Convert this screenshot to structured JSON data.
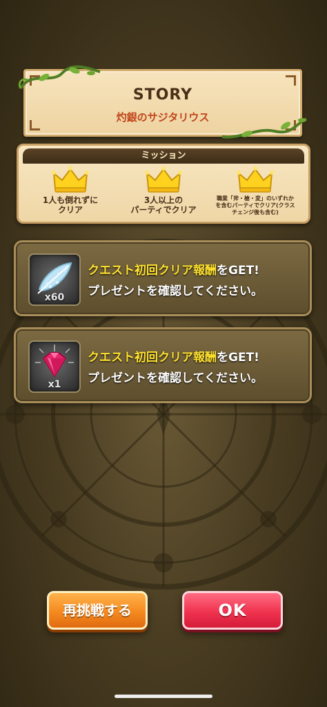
{
  "story": {
    "title": "STORY",
    "subtitle": "灼銀のサジタリウス"
  },
  "mission": {
    "header": "ミッション",
    "items": [
      {
        "line1": "1人も倒れずに",
        "line2": "クリア",
        "icon": "crown-icon"
      },
      {
        "line1": "3人以上の",
        "line2": "パーティでクリア",
        "icon": "crown-icon"
      },
      {
        "line1": "職業「斧・槍・変」のいずれか",
        "line2": "を含むパーティでクリア(クラス",
        "line3": "チェンジ後も含む)",
        "icon": "crown-icon"
      }
    ]
  },
  "rewards": [
    {
      "highlight": "クエスト初回クリア報酬",
      "suffix": "をGET!",
      "line2": "プレゼントを確認してください。",
      "quantity": "x60",
      "icon": "feather-icon"
    },
    {
      "highlight": "クエスト初回クリア報酬",
      "suffix": "をGET!",
      "line2": "プレゼントを確認してください。",
      "quantity": "x1",
      "icon": "gem-icon"
    }
  ],
  "buttons": {
    "retry_label": "再挑戦する",
    "ok_label": "OK"
  },
  "colors": {
    "highlight_text": "#ffe22e",
    "retry_button": "#f58a1f",
    "ok_button": "#f0334f",
    "subtitle": "#c0461c"
  }
}
